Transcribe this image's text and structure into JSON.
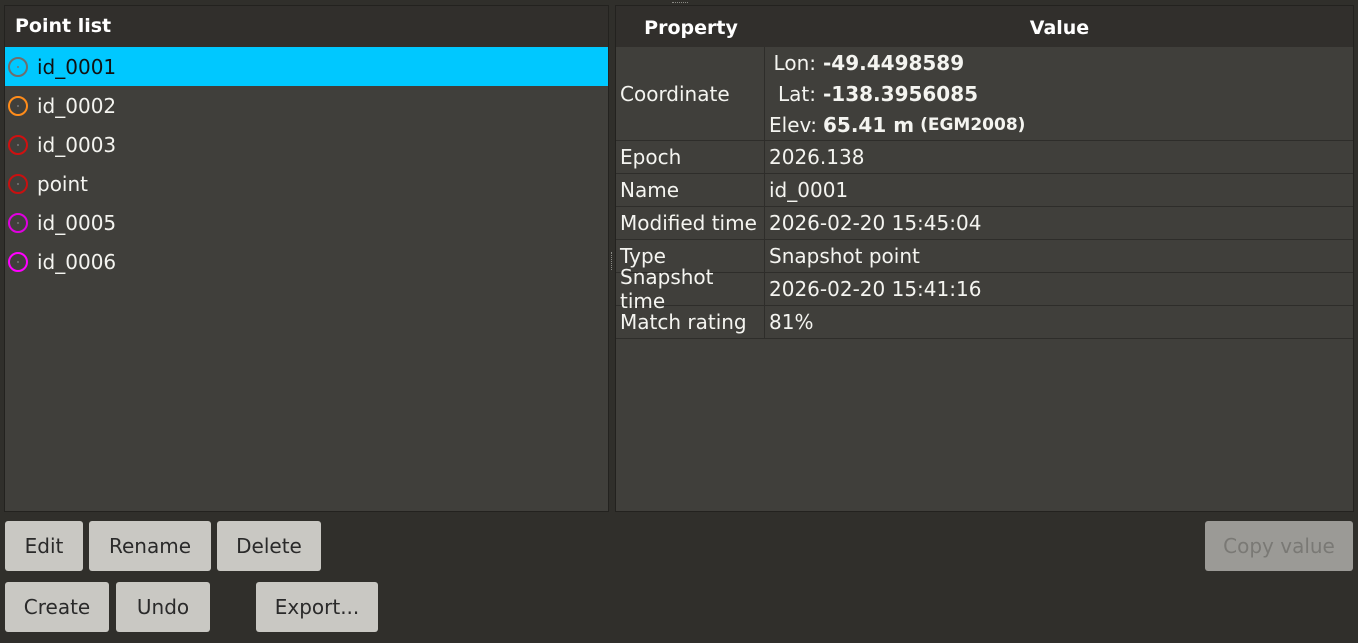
{
  "point_list": {
    "header": "Point list",
    "items": [
      {
        "label": "id_0001",
        "icon_color": "#6e6e6e",
        "icon": "target-marker-icon",
        "selected": true
      },
      {
        "label": "id_0002",
        "icon_color": "#ff8c1a",
        "icon": "target-marker-icon",
        "selected": false
      },
      {
        "label": "id_0003",
        "icon_color": "#d01010",
        "icon": "target-marker-icon",
        "selected": false
      },
      {
        "label": "point",
        "icon_color": "#c81010",
        "icon": "target-marker-icon",
        "selected": false
      },
      {
        "label": "id_0005",
        "icon_color": "#e000e0",
        "icon": "target-marker-icon",
        "selected": false
      },
      {
        "label": "id_0006",
        "icon_color": "#ff00ff",
        "icon": "target-marker-icon",
        "selected": false
      }
    ],
    "selected_color": "#00c8ff"
  },
  "properties": {
    "header_property": "Property",
    "header_value": "Value",
    "coordinate": {
      "label": "Coordinate",
      "lon_key": "Lon:",
      "lon_value": "-49.4498589",
      "lat_key": "Lat:",
      "lat_value": "-138.3956085",
      "elev_key": "Elev:",
      "elev_value": "65.41 m",
      "elev_datum": "(EGM2008)"
    },
    "rows": [
      {
        "property": "Epoch",
        "value": "2026.138"
      },
      {
        "property": "Name",
        "value": "id_0001"
      },
      {
        "property": "Modified time",
        "value": "2026-02-20 15:45:04"
      },
      {
        "property": "Type",
        "value": "Snapshot point"
      },
      {
        "property": "Snapshot time",
        "value": "2026-02-20 15:41:16"
      },
      {
        "property": "Match rating",
        "value": "81%"
      }
    ]
  },
  "buttons": {
    "edit": "Edit",
    "rename": "Rename",
    "delete": "Delete",
    "copy_value": "Copy value",
    "create": "Create",
    "undo": "Undo",
    "export": "Export..."
  }
}
